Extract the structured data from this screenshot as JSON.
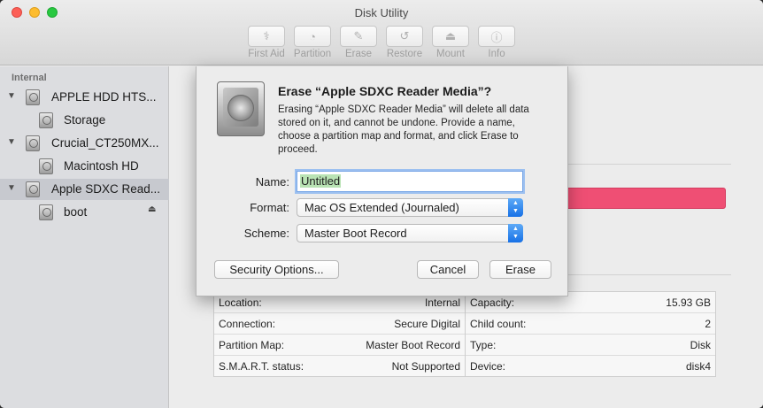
{
  "window": {
    "title": "Disk Utility"
  },
  "toolbar": {
    "items": [
      {
        "label": "First Aid",
        "icon": "stethoscope-icon"
      },
      {
        "label": "Partition",
        "icon": "pie-chart-icon"
      },
      {
        "label": "Erase",
        "icon": "eraser-icon"
      },
      {
        "label": "Restore",
        "icon": "restore-arrow-icon"
      },
      {
        "label": "Mount",
        "icon": "mount-icon"
      },
      {
        "label": "Info",
        "icon": "info-icon"
      }
    ]
  },
  "sidebar": {
    "section": "Internal",
    "items": [
      {
        "label": "APPLE HDD HTS...",
        "level": 0,
        "expanded": true
      },
      {
        "label": "Storage",
        "level": 1
      },
      {
        "label": "Crucial_CT250MX...",
        "level": 0,
        "expanded": true
      },
      {
        "label": "Macintosh HD",
        "level": 1
      },
      {
        "label": "Apple SDXC Read...",
        "level": 0,
        "expanded": true,
        "selected": true
      },
      {
        "label": "boot",
        "level": 1,
        "eject": true
      }
    ]
  },
  "dialog": {
    "title": "Erase “Apple SDXC Reader Media”?",
    "message": "Erasing “Apple SDXC Reader Media” will delete all data stored on it, and cannot be undone. Provide a name, choose a partition map and format, and click Erase to proceed.",
    "name_label": "Name:",
    "name_value": "Untitled",
    "format_label": "Format:",
    "format_value": "Mac OS Extended (Journaled)",
    "scheme_label": "Scheme:",
    "scheme_value": "Master Boot Record",
    "security_button": "Security Options...",
    "cancel_button": "Cancel",
    "erase_button": "Erase"
  },
  "info": {
    "left": [
      {
        "key": "Location:",
        "value": "Internal"
      },
      {
        "key": "Connection:",
        "value": "Secure Digital"
      },
      {
        "key": "Partition Map:",
        "value": "Master Boot Record"
      },
      {
        "key": "S.M.A.R.T. status:",
        "value": "Not Supported"
      }
    ],
    "right": [
      {
        "key": "Capacity:",
        "value": "15.93 GB"
      },
      {
        "key": "Child count:",
        "value": "2"
      },
      {
        "key": "Type:",
        "value": "Disk"
      },
      {
        "key": "Device:",
        "value": "disk4"
      }
    ]
  },
  "colors": {
    "usage_bar": "#ef4f74",
    "selection": "#c7c9cf",
    "accent": "#1771e6"
  }
}
